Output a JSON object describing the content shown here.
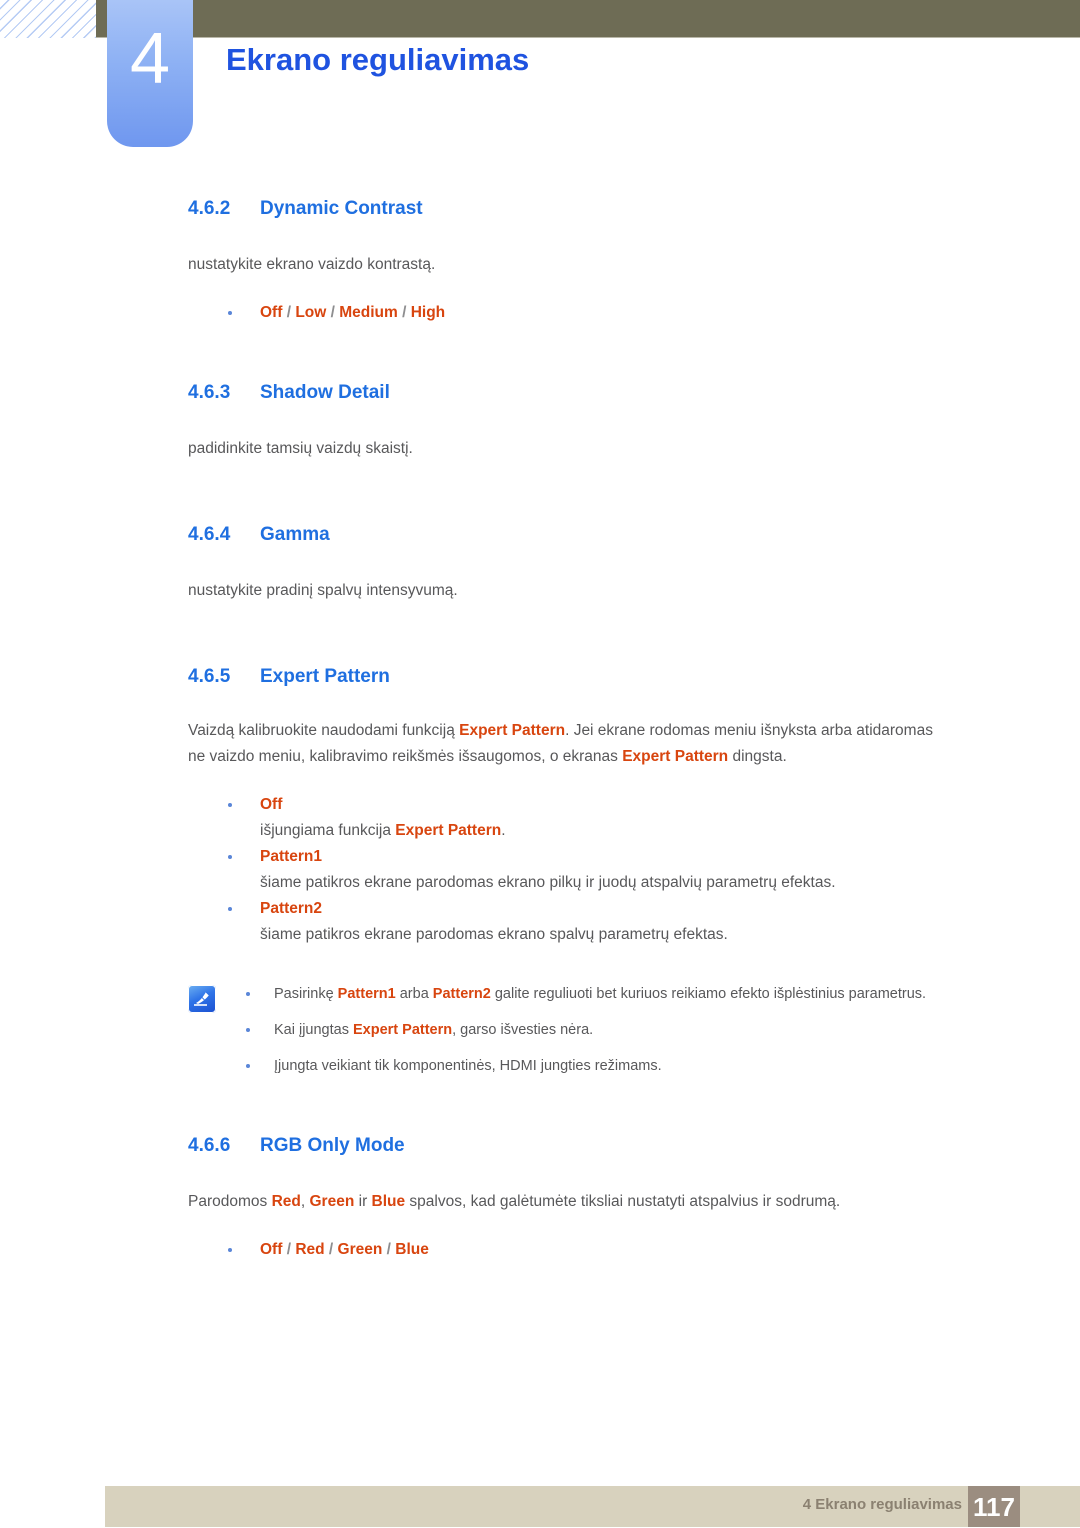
{
  "header": {
    "chapter_number": "4",
    "chapter_title": "Ekrano reguliavimas",
    "badge_color": "#7ea3f2",
    "bar_color": "#6e6c55",
    "title_color": "#1f53e0"
  },
  "colors": {
    "heading": "#1f6fe0",
    "body": "#58585a",
    "highlight": "#d8450f",
    "bullet": "#5a86d8",
    "footer_band": "#d8d2be",
    "page_box": "#9b8d80"
  },
  "sections": {
    "s462": {
      "number": "4.6.2",
      "title": "Dynamic Contrast",
      "body": "nustatykite ekrano vaizdo kontrastą.",
      "options": {
        "o1": "Off",
        "s1": " / ",
        "o2": "Low",
        "s2": " / ",
        "o3": "Medium",
        "s3": " / ",
        "o4": "High"
      }
    },
    "s463": {
      "number": "4.6.3",
      "title": "Shadow Detail",
      "body": "padidinkite tamsių vaizdų skaistį."
    },
    "s464": {
      "number": "4.6.4",
      "title": "Gamma",
      "body": "nustatykite pradinį spalvų intensyvumą."
    },
    "s465": {
      "number": "4.6.5",
      "title": "Expert Pattern",
      "intro_1": "Vaizdą kalibruokite naudodami funkciją ",
      "intro_kw1": "Expert Pattern",
      "intro_2": ". Jei ekrane rodomas meniu išnyksta arba atidaromas ne vaizdo meniu, kalibravimo reikšmės išsaugomos, o ekranas ",
      "intro_kw2": "Expert Pattern",
      "intro_3": " dingsta.",
      "items": {
        "i1_label": "Off",
        "i1_desc_1": "išjungiama funkcija ",
        "i1_desc_kw": "Expert Pattern",
        "i1_desc_2": ".",
        "i2_label": "Pattern1",
        "i2_desc": "šiame patikros ekrane parodomas ekrano pilkų ir juodų atspalvių parametrų efektas.",
        "i3_label": "Pattern2",
        "i3_desc": "šiame patikros ekrane parodomas ekrano spalvų parametrų efektas."
      },
      "note": {
        "icon": "note-pencil-icon",
        "n1_1": "Pasirinkę ",
        "n1_kw1": "Pattern1",
        "n1_2": " arba ",
        "n1_kw2": "Pattern2",
        "n1_3": " galite reguliuoti bet kuriuos reikiamo efekto išplėstinius parametrus.",
        "n2_1": "Kai įjungtas ",
        "n2_kw": "Expert Pattern",
        "n2_2": ", garso išvesties nėra.",
        "n3": "Įjungta veikiant tik komponentinės, HDMI jungties režimams."
      }
    },
    "s466": {
      "number": "4.6.6",
      "title": "RGB Only Mode",
      "body_1": "Parodomos ",
      "body_kw1": "Red",
      "body_2": ", ",
      "body_kw2": "Green",
      "body_3": " ir ",
      "body_kw3": "Blue",
      "body_4": " spalvos, kad galėtumėte tiksliai nustatyti atspalvius ir sodrumą.",
      "options": {
        "o1": "Off",
        "s1": " / ",
        "o2": "Red",
        "s2": " / ",
        "o3": "Green",
        "s3": " / ",
        "o4": "Blue"
      }
    }
  },
  "footer": {
    "text": "4 Ekrano reguliavimas",
    "page_number": "117"
  }
}
